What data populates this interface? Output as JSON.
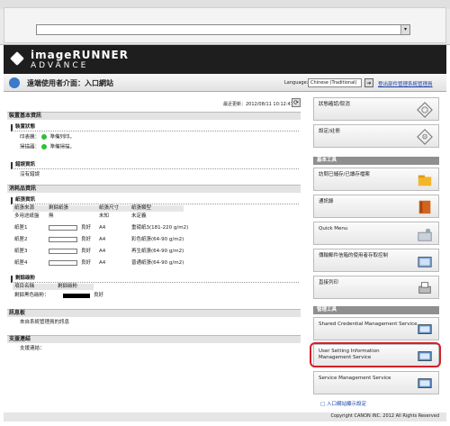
{
  "browser": {
    "address_value": ""
  },
  "brand": {
    "line1": "imageRUNNER",
    "line2": "ADVANCE"
  },
  "header": {
    "page_title": "遠端使用者介面：入口網站",
    "language_label": "Language:",
    "language_value": "Chinese (Traditional)",
    "sysmgr_link": "登出部件管理系統管理員"
  },
  "status": {
    "updated": "最近更新：2012/08/11 10:12:47"
  },
  "device": {
    "section_title": "裝置基本資訊",
    "status_title": "裝置狀態",
    "printer_label": "印表機：",
    "printer_value": "準備列印。",
    "scanner_label": "掃描器：",
    "scanner_value": "準備掃描。",
    "error_title": "錯誤資訊",
    "error_value": "沒有錯誤"
  },
  "consumables": {
    "section_title": "消耗品資訊",
    "paper_title": "紙張資訊",
    "headers": [
      "紙張來源",
      "剩餘紙張",
      "紙張尺寸",
      "紙張類型"
    ],
    "rows": [
      {
        "source": "多用途紙盤",
        "remaining": "無",
        "size": "未知",
        "type": "未定義",
        "bar": false
      },
      {
        "source": "紙匣1",
        "remaining": "良好",
        "size": "A4",
        "type": "重磅紙3(181-220 g/m2)",
        "bar": true
      },
      {
        "source": "紙匣2",
        "remaining": "良好",
        "size": "A4",
        "type": "彩色紙張(64-90 g/m2)",
        "bar": true
      },
      {
        "source": "紙匣3",
        "remaining": "良好",
        "size": "A4",
        "type": "再生紙張(64-90 g/m2)",
        "bar": true
      },
      {
        "source": "紙匣4",
        "remaining": "良好",
        "size": "A4",
        "type": "普通紙張(64-90 g/m2)",
        "bar": true
      }
    ],
    "toner_title": "剩餘碳粉",
    "toner_headers": [
      "項目名稱",
      "剩餘碳粉"
    ],
    "toner_row": {
      "name": "剩餘黑色碳粉：",
      "value": "良好"
    }
  },
  "messages": {
    "section_title": "訊息板",
    "value": "來自系統管理員的訊息"
  },
  "support": {
    "section_title": "支援連結",
    "value": "支援連結："
  },
  "sidebar": {
    "btn_status": "狀態確認/取消",
    "btn_settings": "設定/註冊",
    "basic_tools": "基本工具",
    "btn_box": "訪問已儲存/已讀存檔案",
    "btn_addressbook": "通訊錄",
    "btn_quickmenu": "Quick Menu",
    "btn_dept": "傳輸郵件信箱的使用者存取控制",
    "btn_directprint": "直接列印",
    "mgmt_tools": "管理工具",
    "btn_shared": "Shared Credential Management Service",
    "btn_usersetting": "User Setting Information Management Service",
    "btn_servicemgmt": "Service Management Service",
    "portal_link": "入口網站顯示設定"
  },
  "footer": {
    "copyright": "Copyright CANON INC. 2012 All Rights Reserved"
  }
}
